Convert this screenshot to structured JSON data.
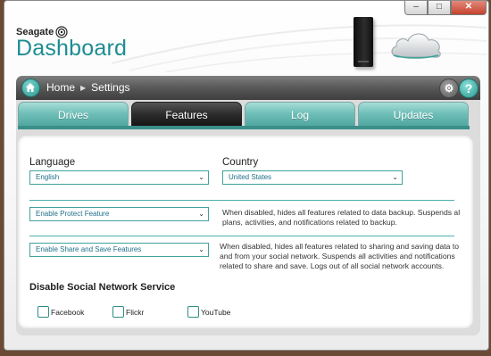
{
  "window": {
    "controls": {
      "minimize": "–",
      "maximize": "□",
      "close": "✕"
    }
  },
  "brand": {
    "vendor": "Seagate",
    "product": "Dashboard"
  },
  "nav": {
    "breadcrumb": [
      "Home",
      "Settings"
    ],
    "gear_icon": "gear-icon",
    "help_label": "?"
  },
  "tabs": [
    {
      "label": "Drives",
      "active": false
    },
    {
      "label": "Features",
      "active": true
    },
    {
      "label": "Log",
      "active": false
    },
    {
      "label": "Updates",
      "active": false
    }
  ],
  "settings": {
    "language_label": "Language",
    "language_value": "English",
    "country_label": "Country",
    "country_value": "United States",
    "protect_select": "Enable Protect Feature",
    "protect_desc": "When disabled, hides all features related to data backup. Suspends al plans, activities, and notifications related to backup.",
    "share_select": "Enable Share and Save Features",
    "share_desc": "When disabled, hides all features related to sharing and saving data to and from your social network. Suspends all activities and notifications related to share and save. Logs out of all social network accounts.",
    "social_title": "Disable Social Network Service",
    "social": [
      {
        "label": "Facebook",
        "checked": false
      },
      {
        "label": "Flickr",
        "checked": false
      },
      {
        "label": "YouTube",
        "checked": false
      }
    ]
  },
  "colors": {
    "accent": "#1e8c92",
    "tab_teal": "#6fbfb8",
    "tab_active": "#2b2b2b",
    "desktop_bg": "#6b4a35"
  }
}
